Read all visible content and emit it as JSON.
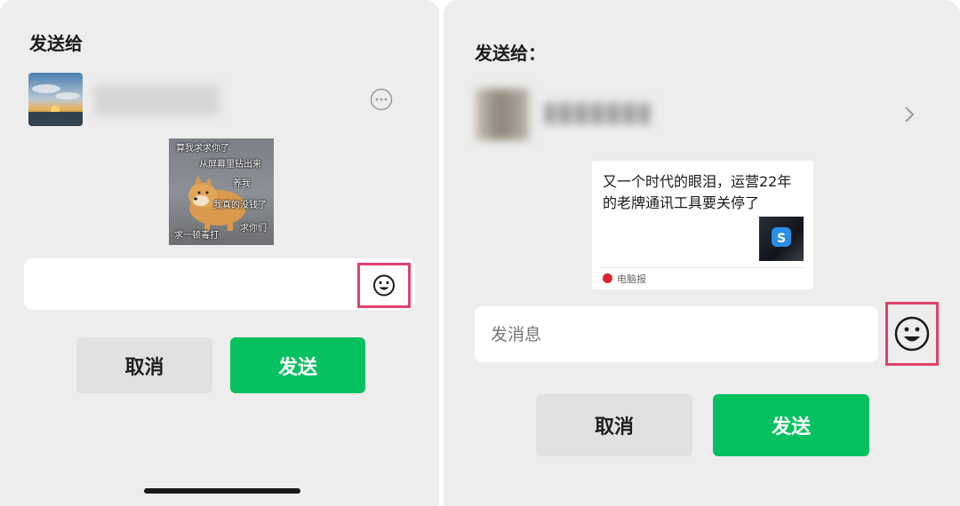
{
  "left": {
    "title": "发送给",
    "recipient": {
      "avatar": "sunset-landscape-avatar",
      "name": ""
    },
    "sticker_lines": [
      "算我求求你了",
      "从屏幕里钻出来",
      "养我",
      "我真的没钱了",
      "求你们",
      "求一顿毒打"
    ],
    "input": {
      "value": "",
      "placeholder": ""
    },
    "buttons": {
      "cancel": "取消",
      "send": "发送"
    },
    "icons": {
      "more": "more-dots-icon",
      "emoji": "smiley-face-icon"
    },
    "colors": {
      "send": "#07c160",
      "highlight": "#e0426a"
    }
  },
  "right": {
    "title": "发送给：",
    "recipient": {
      "avatar": "contact-avatar",
      "name": ""
    },
    "article": {
      "title": "又一个时代的眼泪，运营22年的老牌通讯工具要关停了",
      "source": "电脑报",
      "thumbnail": "skype-logo-thumbnail"
    },
    "input": {
      "value": "",
      "placeholder": "发消息"
    },
    "buttons": {
      "cancel": "取消",
      "send": "发送"
    },
    "icons": {
      "chevron": "chevron-right-icon",
      "emoji": "smiley-face-icon"
    },
    "colors": {
      "send": "#07c160",
      "highlight": "#e0426a"
    }
  }
}
